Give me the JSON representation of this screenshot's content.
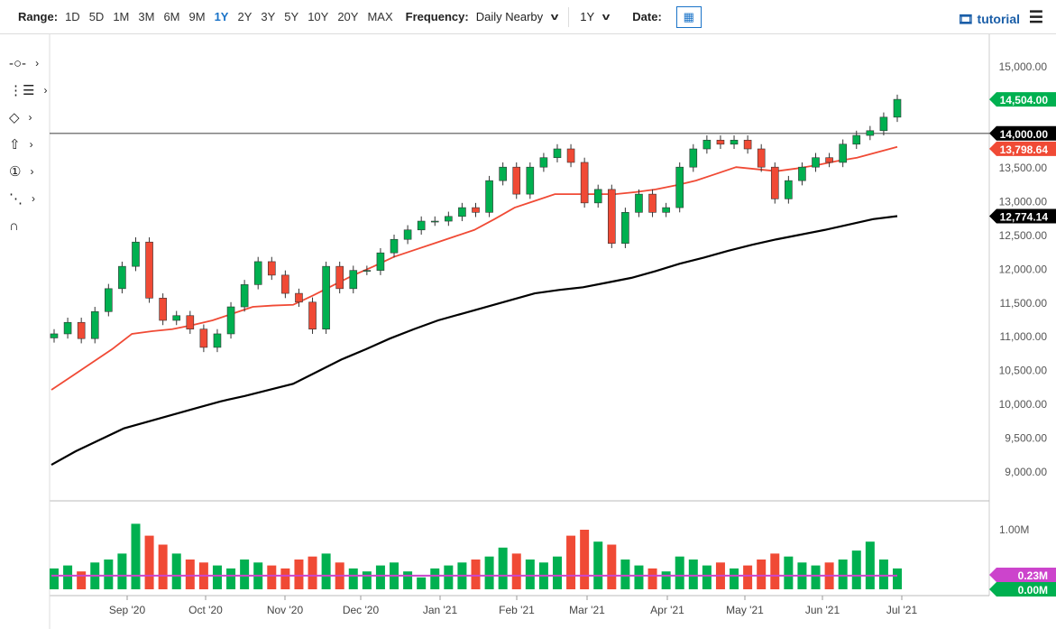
{
  "toolbar": {
    "range_label": "Range:",
    "ranges": [
      "1D",
      "5D",
      "1M",
      "3M",
      "6M",
      "9M",
      "1Y",
      "2Y",
      "3Y",
      "5Y",
      "10Y",
      "20Y",
      "MAX"
    ],
    "active_range": "1Y",
    "frequency_label": "Frequency:",
    "frequency": "Daily Nearby",
    "period": "1Y",
    "date_label": "Date:",
    "tutorial": "tutorial"
  },
  "colors": {
    "up": "#00b050",
    "down": "#f04a35",
    "ma50": "#f04a35",
    "ma200": "#000000",
    "vol_avg": "#cc44cc"
  },
  "chart_data": {
    "type": "candlestick",
    "y_ticks": [
      "15,000.00",
      "14,500.00",
      "14,000.00",
      "13,500.00",
      "13,000.00",
      "12,500.00",
      "12,000.00",
      "11,500.00",
      "11,000.00",
      "10,500.00",
      "10,000.00",
      "9,500.00",
      "9,000.00"
    ],
    "ylim": [
      8700,
      15200
    ],
    "x_labels": [
      "Sep '20",
      "Oct '20",
      "Nov '20",
      "Dec '20",
      "Jan '21",
      "Feb '21",
      "Mar '21",
      "Apr '21",
      "May '21",
      "Jun '21",
      "Jul '21"
    ],
    "close": [
      11030,
      11200,
      10960,
      11360,
      11700,
      12030,
      12390,
      11560,
      11230,
      11300,
      11100,
      10830,
      11030,
      11430,
      11760,
      12100,
      11900,
      11630,
      11500,
      11100,
      12030,
      11700,
      11970,
      11970,
      12230,
      12430,
      12570,
      12700,
      12700,
      12770,
      12900,
      12830,
      13300,
      13500,
      13100,
      13500,
      13640,
      13770,
      13570,
      12970,
      13170,
      12370,
      12830,
      13100,
      12830,
      12900,
      13500,
      13770,
      13900,
      13840,
      13900,
      13770,
      13500,
      13030,
      13300,
      13500,
      13640,
      13570,
      13840,
      13970,
      14040,
      14240,
      14504
    ],
    "ma50": [
      10200,
      10400,
      10600,
      10800,
      11030,
      11070,
      11100,
      11160,
      11230,
      11330,
      11430,
      11450,
      11460,
      11600,
      11750,
      11900,
      12030,
      12170,
      12270,
      12370,
      12470,
      12570,
      12730,
      12900,
      13000,
      13100,
      13100,
      13100,
      13100,
      13130,
      13170,
      13230,
      13300,
      13400,
      13500,
      13470,
      13440,
      13480,
      13530,
      13590,
      13640,
      13720,
      13800
    ],
    "ma200": [
      9090,
      9290,
      9460,
      9630,
      9730,
      9830,
      9930,
      10030,
      10110,
      10200,
      10290,
      10470,
      10650,
      10800,
      10960,
      11100,
      11230,
      11330,
      11430,
      11530,
      11630,
      11680,
      11720,
      11790,
      11860,
      11960,
      12070,
      12160,
      12260,
      12350,
      12430,
      12500,
      12570,
      12650,
      12730,
      12774
    ],
    "volume": [
      0.35,
      0.4,
      0.3,
      0.45,
      0.5,
      0.6,
      1.1,
      0.9,
      0.75,
      0.6,
      0.5,
      0.45,
      0.4,
      0.35,
      0.5,
      0.45,
      0.4,
      0.35,
      0.5,
      0.55,
      0.6,
      0.45,
      0.35,
      0.3,
      0.4,
      0.45,
      0.3,
      0.2,
      0.35,
      0.4,
      0.45,
      0.5,
      0.55,
      0.7,
      0.6,
      0.5,
      0.45,
      0.55,
      0.9,
      1.0,
      0.8,
      0.75,
      0.5,
      0.4,
      0.35,
      0.3,
      0.55,
      0.5,
      0.4,
      0.45,
      0.35,
      0.4,
      0.5,
      0.6,
      0.55,
      0.45,
      0.4,
      0.45,
      0.5,
      0.65,
      0.8,
      0.5,
      0.35
    ],
    "vol_avg": 0.23,
    "vol_ticks": [
      "1.00M"
    ],
    "labels": {
      "last": "14,504.00",
      "level": "14,000.00",
      "ma50": "13,798.64",
      "ma200": "12,774.14",
      "vol_avg": "0.23M",
      "vol_last": "0.00M"
    },
    "hline": 14000
  }
}
